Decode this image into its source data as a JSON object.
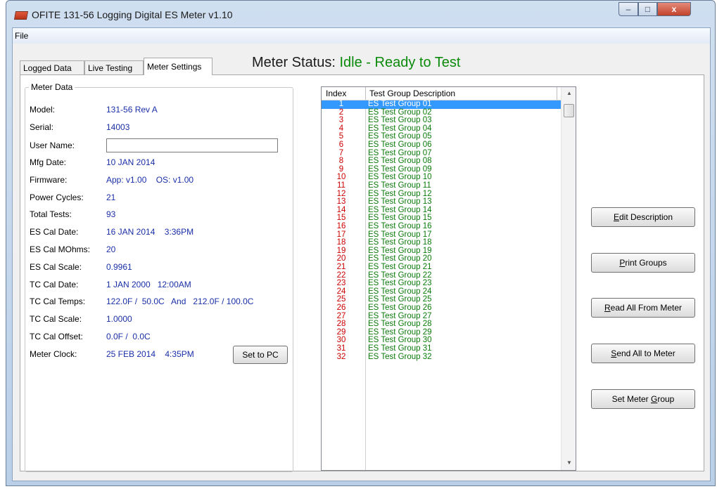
{
  "window": {
    "title": "OFITE 131-56 Logging Digital ES Meter   v1.10",
    "controls": {
      "minimize": "–",
      "maximize": "□",
      "close": "x"
    }
  },
  "menu": {
    "file": "File"
  },
  "tabs": [
    {
      "label": "Logged Data"
    },
    {
      "label": "Live Testing"
    },
    {
      "label": "Meter Settings"
    }
  ],
  "status": {
    "label": "Meter Status:",
    "value": "Idle - Ready to Test"
  },
  "meter_data": {
    "title": "Meter Data",
    "model": {
      "label": "Model:",
      "value": "131-56  Rev A"
    },
    "serial": {
      "label": "Serial:",
      "value": "14003"
    },
    "user_name": {
      "label": "User Name:",
      "value": ""
    },
    "mfg_date": {
      "label": "Mfg Date:",
      "value": "10 JAN 2014"
    },
    "firmware": {
      "label": "Firmware:",
      "value": "App: v1.00    OS: v1.00"
    },
    "power_cycles": {
      "label": "Power Cycles:",
      "value": "21"
    },
    "total_tests": {
      "label": "Total Tests:",
      "value": "93"
    },
    "es_cal_date": {
      "label": "ES Cal Date:",
      "value": "16 JAN 2014    3:36PM"
    },
    "es_cal_mohms": {
      "label": "ES Cal MOhms:",
      "value": "20"
    },
    "es_cal_scale": {
      "label": "ES Cal Scale:",
      "value": "0.9961"
    },
    "tc_cal_date": {
      "label": "TC Cal Date:",
      "value": "1 JAN 2000   12:00AM"
    },
    "tc_cal_temps": {
      "label": "TC Cal Temps:",
      "value": "122.0F /  50.0C   And   212.0F / 100.0C"
    },
    "tc_cal_scale": {
      "label": "TC Cal Scale:",
      "value": "1.0000"
    },
    "tc_cal_offset": {
      "label": "TC Cal Offset:",
      "value": "0.0F /  0.0C"
    },
    "meter_clock": {
      "label": "Meter Clock:",
      "value": "25 FEB 2014    4:35PM"
    },
    "set_to_pc": "Set to PC"
  },
  "group_list": {
    "headers": {
      "index": "Index",
      "description": "Test Group Description"
    },
    "selected_index": "1",
    "rows": [
      {
        "index": "1",
        "description": "ES Test Group 01"
      },
      {
        "index": "2",
        "description": "ES Test Group 02"
      },
      {
        "index": "3",
        "description": "ES Test Group 03"
      },
      {
        "index": "4",
        "description": "ES Test Group 04"
      },
      {
        "index": "5",
        "description": "ES Test Group 05"
      },
      {
        "index": "6",
        "description": "ES Test Group 06"
      },
      {
        "index": "7",
        "description": "ES Test Group 07"
      },
      {
        "index": "8",
        "description": "ES Test Group 08"
      },
      {
        "index": "9",
        "description": "ES Test Group 09"
      },
      {
        "index": "10",
        "description": "ES Test Group 10"
      },
      {
        "index": "11",
        "description": "ES Test Group 11"
      },
      {
        "index": "12",
        "description": "ES Test Group 12"
      },
      {
        "index": "13",
        "description": "ES Test Group 13"
      },
      {
        "index": "14",
        "description": "ES Test Group 14"
      },
      {
        "index": "15",
        "description": "ES Test Group 15"
      },
      {
        "index": "16",
        "description": "ES Test Group 16"
      },
      {
        "index": "17",
        "description": "ES Test Group 17"
      },
      {
        "index": "18",
        "description": "ES Test Group 18"
      },
      {
        "index": "19",
        "description": "ES Test Group 19"
      },
      {
        "index": "20",
        "description": "ES Test Group 20"
      },
      {
        "index": "21",
        "description": "ES Test Group 21"
      },
      {
        "index": "22",
        "description": "ES Test Group 22"
      },
      {
        "index": "23",
        "description": "ES Test Group 23"
      },
      {
        "index": "24",
        "description": "ES Test Group 24"
      },
      {
        "index": "25",
        "description": "ES Test Group 25"
      },
      {
        "index": "26",
        "description": "ES Test Group 26"
      },
      {
        "index": "27",
        "description": "ES Test Group 27"
      },
      {
        "index": "28",
        "description": "ES Test Group 28"
      },
      {
        "index": "29",
        "description": "ES Test Group 29"
      },
      {
        "index": "30",
        "description": "ES Test Group 30"
      },
      {
        "index": "31",
        "description": "ES Test Group 31"
      },
      {
        "index": "32",
        "description": "ES Test Group 32"
      }
    ]
  },
  "actions": {
    "edit_description": {
      "pre": "",
      "key": "E",
      "post": "dit Description"
    },
    "print_groups": {
      "pre": "",
      "key": "P",
      "post": "rint Groups"
    },
    "read_all": {
      "pre": "",
      "key": "R",
      "post": "ead All From Meter"
    },
    "send_all": {
      "pre": "",
      "key": "S",
      "post": "end All to Meter"
    },
    "set_meter_group": {
      "pre": "Set Meter ",
      "key": "G",
      "post": "roup"
    }
  },
  "colors": {
    "status_value": "#0a8a0a",
    "field_value": "#1a2fa8",
    "index_text": "#cc0000",
    "description_text": "#0a7a0a",
    "selection": "#3399ff"
  }
}
